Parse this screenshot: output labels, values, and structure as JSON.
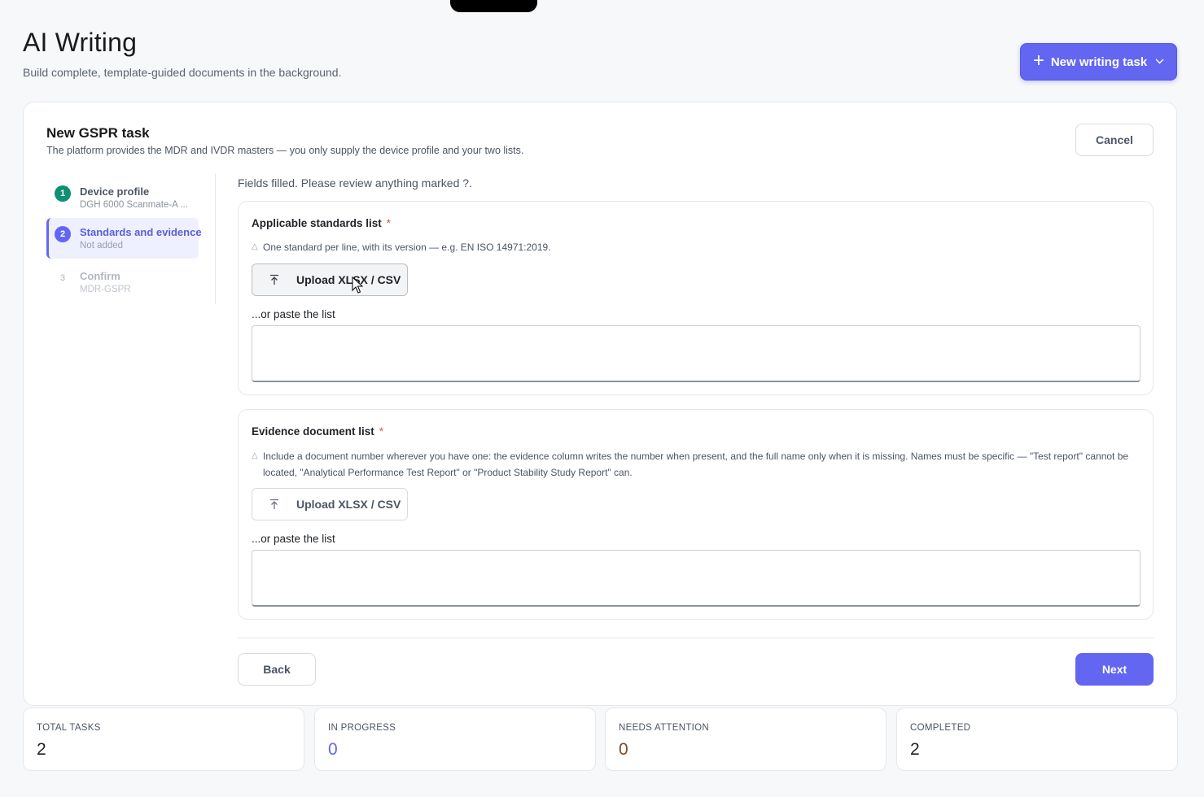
{
  "header": {
    "title": "AI Writing",
    "subtitle": "Build complete, template-guided documents in the background.",
    "new_task_label": "New writing task"
  },
  "task": {
    "title": "New GSPR task",
    "subtitle": "The platform provides the MDR and IVDR masters — you only supply the device profile and your two lists.",
    "cancel_label": "Cancel",
    "status_text": "Fields filled. Please review anything marked ?."
  },
  "steps": [
    {
      "number": "1",
      "label": "Device profile",
      "sub": "DGH 6000 Scanmate-A ...",
      "state": "done"
    },
    {
      "number": "2",
      "label": "Standards and evidence",
      "sub": "Not added",
      "state": "active"
    },
    {
      "number": "3",
      "label": "Confirm",
      "sub": "MDR-GSPR",
      "state": "pending"
    }
  ],
  "standards": {
    "title": "Applicable standards list",
    "required_mark": "*",
    "hint": "One standard per line, with its version — e.g. EN ISO 14971:2019.",
    "upload_label": "Upload XLSX / CSV",
    "paste_label": "...or paste the list",
    "value": ""
  },
  "evidence": {
    "title": "Evidence document list",
    "required_mark": "*",
    "hint": "Include a document number wherever you have one: the evidence column writes the number when present, and the full name only when it is missing. Names must be specific — \"Test report\" cannot be located, \"Analytical Performance Test Report\" or \"Product Stability Study Report\" can.",
    "upload_label": "Upload XLSX / CSV",
    "paste_label": "...or paste the list",
    "value": ""
  },
  "nav": {
    "back_label": "Back",
    "next_label": "Next"
  },
  "stats": [
    {
      "label": "TOTAL TASKS",
      "value": "2",
      "color": "#1f2328"
    },
    {
      "label": "IN PROGRESS",
      "value": "0",
      "color": "#6366f1"
    },
    {
      "label": "NEEDS ATTENTION",
      "value": "0",
      "color": "#7a4a2a"
    },
    {
      "label": "COMPLETED",
      "value": "2",
      "color": "#1f2328"
    }
  ],
  "colors": {
    "accent": "#6366f1",
    "done": "#0f8f73",
    "required": "#e0583a"
  }
}
